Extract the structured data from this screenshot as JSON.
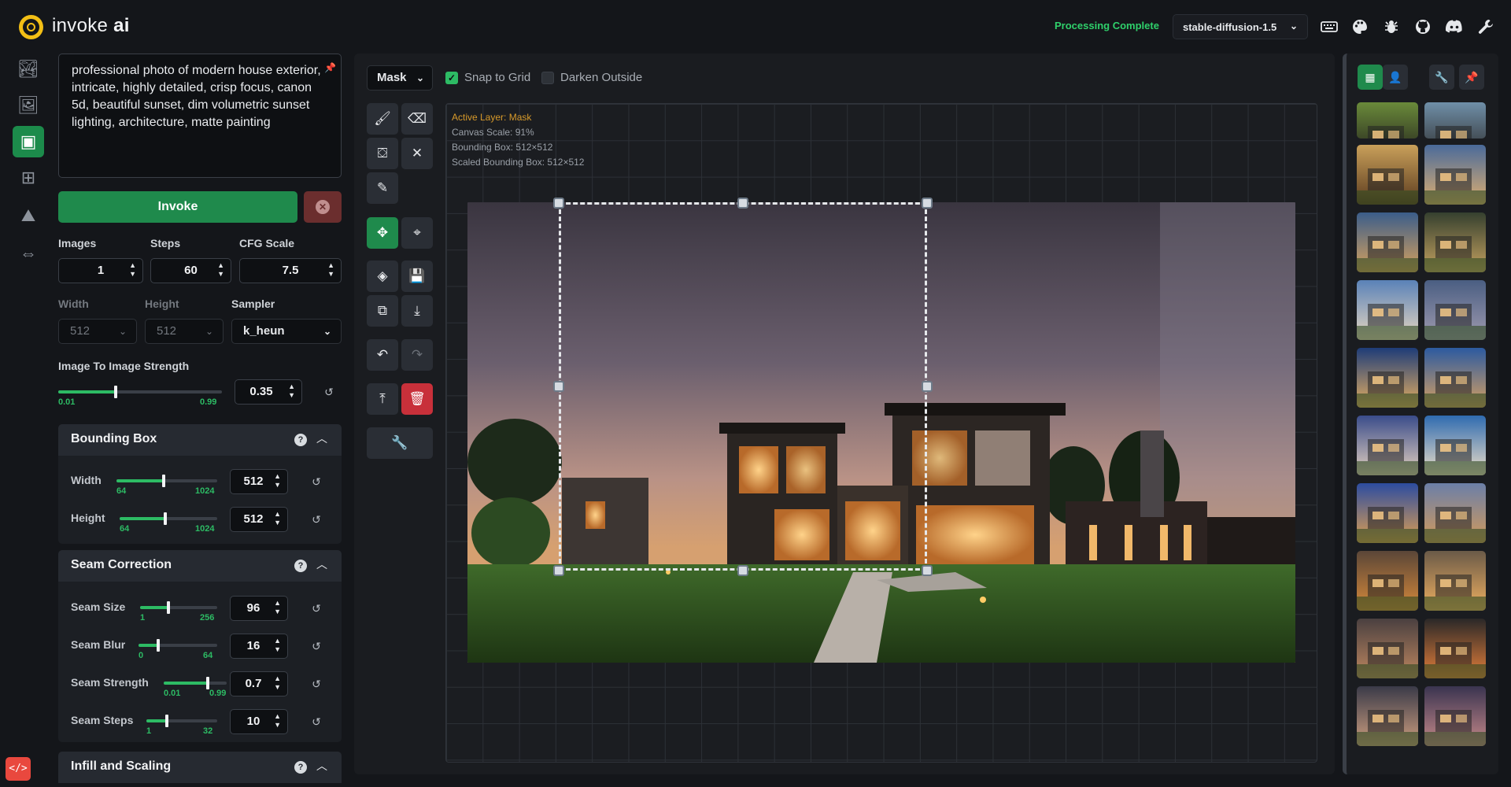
{
  "header": {
    "app_name": "invoke",
    "app_name_bold": "ai",
    "status": "Processing Complete",
    "model": "stable-diffusion-1.5",
    "icons": [
      "keyboard-icon",
      "palette-icon",
      "bug-icon",
      "github-icon",
      "discord-icon",
      "wrench-icon"
    ]
  },
  "rail": {
    "tabs": [
      "text-to-image",
      "image-to-image",
      "unified-canvas",
      "nodes",
      "postprocessing",
      "training"
    ],
    "active": "unified-canvas"
  },
  "prompt": {
    "text": "professional photo of modern house exterior, intricate, highly detailed, crisp focus, canon 5d, beautiful sunset, dim volumetric sunset lighting, architecture, matte painting"
  },
  "actions": {
    "invoke_label": "Invoke"
  },
  "params": {
    "images_label": "Images",
    "images_value": "1",
    "steps_label": "Steps",
    "steps_value": "60",
    "cfg_label": "CFG Scale",
    "cfg_value": "7.5",
    "width_label": "Width",
    "width_value": "512",
    "height_label": "Height",
    "height_value": "512",
    "sampler_label": "Sampler",
    "sampler_value": "k_heun",
    "strength_label": "Image To Image Strength",
    "strength_value": "0.35",
    "strength_min": "0.01",
    "strength_max": "0.99",
    "strength_fraction": 0.35
  },
  "bounding_box": {
    "title": "Bounding Box",
    "width_label": "Width",
    "width_value": "512",
    "width_min": "64",
    "width_max": "1024",
    "width_fraction": 0.47,
    "height_label": "Height",
    "height_value": "512",
    "height_min": "64",
    "height_max": "1024",
    "height_fraction": 0.47
  },
  "seam_correction": {
    "title": "Seam Correction",
    "size_label": "Seam Size",
    "size_value": "96",
    "size_min": "1",
    "size_max": "256",
    "size_fraction": 0.37,
    "blur_label": "Seam Blur",
    "blur_value": "16",
    "blur_min": "0",
    "blur_max": "64",
    "blur_fraction": 0.25,
    "strength_label": "Seam Strength",
    "strength_value": "0.7",
    "strength_min": "0.01",
    "strength_max": "0.99",
    "strength_fraction": 0.7,
    "steps_label": "Seam Steps",
    "steps_value": "10",
    "steps_min": "1",
    "steps_max": "32",
    "steps_fraction": 0.29
  },
  "infill": {
    "title": "Infill and Scaling"
  },
  "canvas": {
    "layer_select": "Mask",
    "snap_label": "Snap to Grid",
    "snap_checked": true,
    "darken_label": "Darken Outside",
    "darken_checked": false,
    "info_active_layer": "Active Layer: Mask",
    "info_scale": "Canvas Scale: 91%",
    "info_bbox": "Bounding Box: 512×512",
    "info_scaled_bbox": "Scaled Bounding Box: 512×512"
  },
  "gallery": {
    "colors": {
      "accent": "#1f8a4c",
      "status_ok": "#2fd06b",
      "danger": "#c8303a"
    }
  }
}
